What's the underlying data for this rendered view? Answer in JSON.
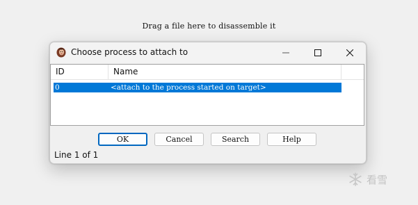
{
  "background_hint": "Drag a file here to disassemble it",
  "dialog": {
    "title": "Choose process to attach to",
    "title_icon": "app-avatar-icon",
    "controls": {
      "minimize_icon": "minimize-icon",
      "maximize_icon": "maximize-icon",
      "close_icon": "close-icon"
    },
    "table": {
      "columns": [
        "ID",
        "Name"
      ],
      "rows": [
        {
          "id": "0",
          "name": "<attach to the process started on target>",
          "selected": true
        }
      ]
    },
    "buttons": {
      "ok": "OK",
      "cancel": "Cancel",
      "search": "Search",
      "help": "Help"
    },
    "status": "Line 1 of 1"
  },
  "watermark": {
    "icon": "snowflake-icon",
    "text": "看雪"
  },
  "colors": {
    "selection": "#0078d7",
    "default_button_border": "#0067c0",
    "window_bg": "#f0f0f0"
  }
}
